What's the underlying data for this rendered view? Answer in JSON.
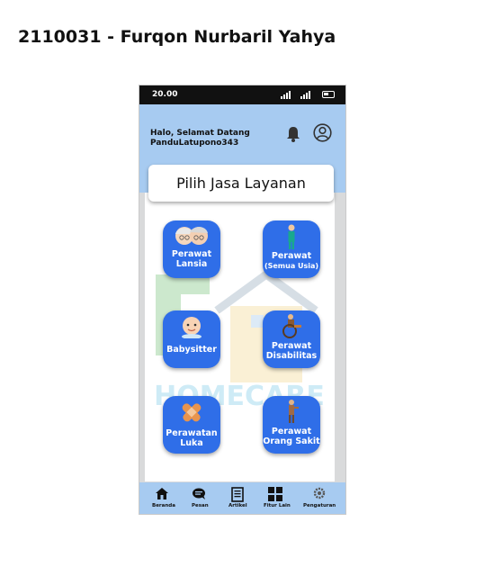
{
  "page": {
    "title": "2110031 - Furqon Nurbaril Yahya"
  },
  "status_bar": {
    "time": "20.00"
  },
  "header": {
    "greeting": "Halo, Selamat Datang",
    "username": "PanduLatupono343"
  },
  "service_card": {
    "title": "Pilih Jasa Layanan"
  },
  "services": [
    {
      "line1": "Perawat",
      "line2": "Lansia",
      "icon": "elderly-couple-icon"
    },
    {
      "line1": "Perawat",
      "line2": "(Semua Usia)",
      "icon": "nurse-icon"
    },
    {
      "line1": "Babysitter",
      "line2": "",
      "icon": "baby-icon"
    },
    {
      "line1": "Perawat",
      "line2": "Disabilitas",
      "icon": "wheelchair-icon"
    },
    {
      "line1": "Perawatan",
      "line2": "Luka",
      "icon": "bandage-icon"
    },
    {
      "line1": "Perawat",
      "line2": "Orang Sakit",
      "icon": "sick-person-icon"
    }
  ],
  "watermark": {
    "text": "HOMECARE"
  },
  "bottom_nav": [
    {
      "label": "Beranda",
      "icon": "home-icon"
    },
    {
      "label": "Pesan",
      "icon": "chat-icon"
    },
    {
      "label": "Artikel",
      "icon": "article-icon"
    },
    {
      "label": "Fitur Lain",
      "icon": "grid-icon"
    },
    {
      "label": "Pengaturan",
      "icon": "settings-icon"
    }
  ],
  "colors": {
    "accent": "#2f6ee8",
    "header": "#a7cbf1",
    "background": "#ffffff"
  }
}
